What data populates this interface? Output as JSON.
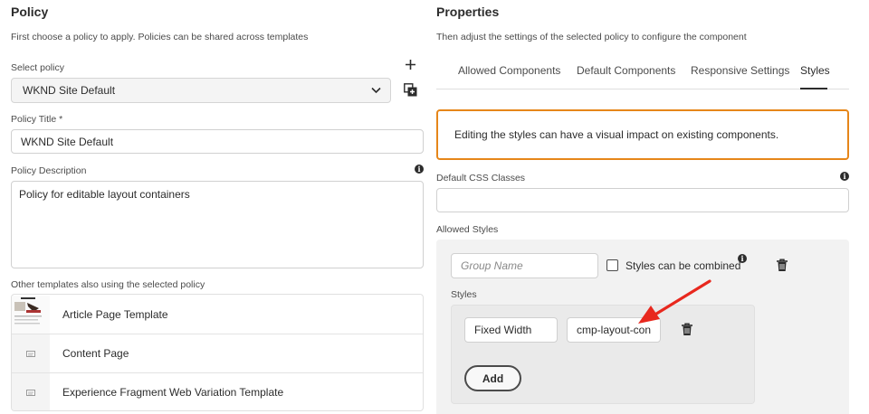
{
  "left": {
    "title": "Policy",
    "subtitle": "First choose a policy to apply. Policies can be shared across templates",
    "select_policy_label": "Select policy",
    "select_policy_value": "WKND Site Default",
    "policy_title_label": "Policy Title *",
    "policy_title_value": "WKND Site Default",
    "policy_description_label": "Policy Description",
    "policy_description_value": "Policy for editable layout containers",
    "other_templates_label": "Other templates also using the selected policy",
    "templates": [
      {
        "name": "Article Page Template",
        "thumb": "article-thumbnail"
      },
      {
        "name": "Content Page",
        "thumb": "page-icon"
      },
      {
        "name": "Experience Fragment Web Variation Template",
        "thumb": "page-icon"
      }
    ]
  },
  "right": {
    "title": "Properties",
    "subtitle": "Then adjust the settings of the selected policy to configure the component",
    "tabs": [
      {
        "label": "Allowed Components",
        "active": false
      },
      {
        "label": "Default Components",
        "active": false
      },
      {
        "label": "Responsive Settings",
        "active": false
      },
      {
        "label": "Styles",
        "active": true
      }
    ],
    "alert_text": "Editing the styles can have a visual impact on existing components.",
    "default_css_label": "Default CSS Classes",
    "default_css_value": "",
    "allowed_styles_label": "Allowed Styles",
    "group_name_placeholder": "Group Name",
    "styles_combined_label": "Styles can be combined",
    "styles_combined_checked": false,
    "styles_label": "Styles",
    "style_name_value": "Fixed Width",
    "style_class_value": "cmp-layout-con",
    "add_button_label": "Add"
  },
  "colors": {
    "alert_border": "#e68619",
    "annotation_arrow": "#e8281e",
    "active_tab_underline": "#2c2c2c",
    "panel_bg": "#f2f2f2"
  },
  "icons": [
    "add-icon",
    "copy-policy-icon",
    "chevron-down-icon",
    "info-icon",
    "trash-icon",
    "page-icon",
    "annotation-arrow"
  ]
}
